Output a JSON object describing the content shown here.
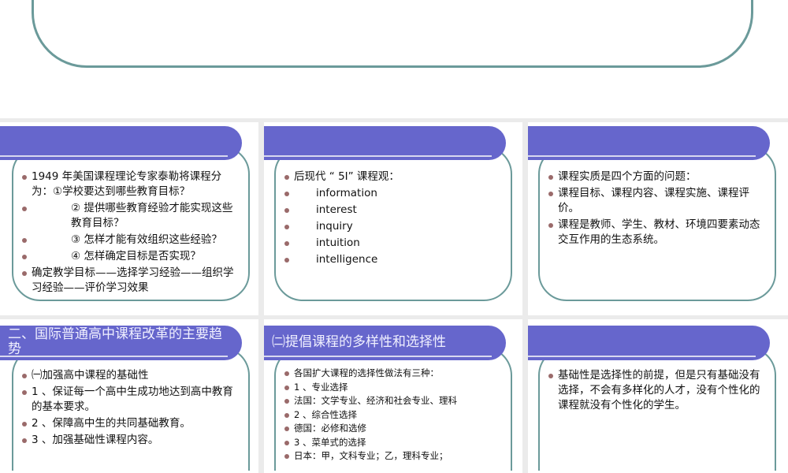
{
  "slides": [
    {
      "title": "",
      "items": [
        "1949 年美国课程理论专家泰勒将课程分为：①学校要达到哪些教育目标？",
        "② 提供哪些教育经验才能实现这些教育目标？",
        "③ 怎样才能有效组织这些经验？",
        "④ 怎样确定目标是否实现？",
        "确定教学目标——选择学习经验——组织学习经验——评价学习效果"
      ]
    },
    {
      "title": "",
      "items": [
        "后现代 “ 5I” 课程观：",
        "information",
        "interest",
        "inquiry",
        "intuition",
        "intelligence"
      ]
    },
    {
      "title": "",
      "items": [
        "课程实质是四个方面的问题：",
        "课程目标、课程内容、课程实施、课程评价。",
        "课程是教师、学生、教材、环境四要素动态交互作用的生态系统。"
      ]
    },
    {
      "title": "二、国际普通高中课程改革的主要趋势",
      "items": [
        "㈠加强高中课程的基础性",
        "1 、保证每一个高中生成功地达到高中教育的基本要求。",
        "2 、保障高中生的共同基础教育。",
        "3 、加强基础性课程内容。"
      ]
    },
    {
      "title": "㈡提倡课程的多样性和选择性",
      "items": [
        "各国扩大课程的选择性做法有三种：",
        "1 、专业选择",
        "法国：文学专业、经济和社会专业、理科",
        "2 、综合性选择",
        "德国：必修和选修",
        "3 、菜单式的选择",
        "日本：甲，文科专业；乙，理科专业；"
      ]
    },
    {
      "title": "",
      "items": [
        "基础性是选择性的前提，但是只有基础没有选择，不会有多样化的人才，没有个性化的课程就没有个性化的学生。"
      ]
    }
  ],
  "colors": {
    "band": "#6666cc",
    "border": "#6b9a9a",
    "bullet": "#9a6a6a"
  }
}
